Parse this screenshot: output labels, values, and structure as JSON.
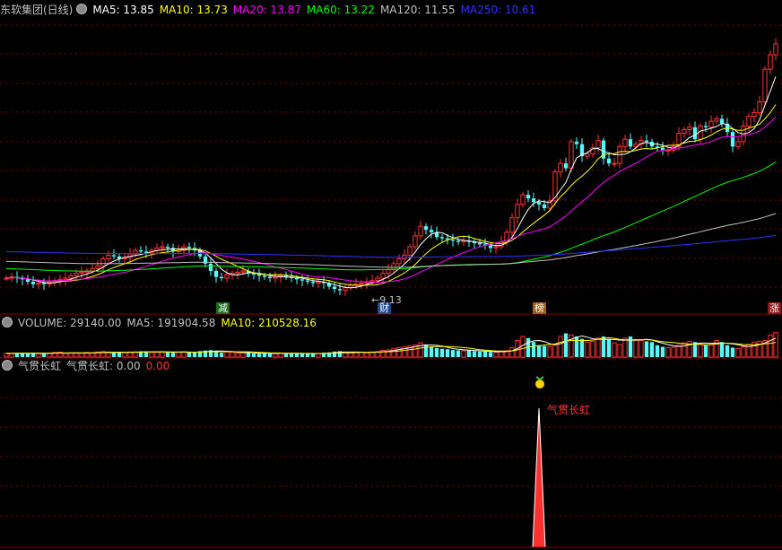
{
  "main_header": {
    "title": "东软集团(日线)",
    "ma": [
      {
        "label": "MA5: 13.85",
        "color": "#ffffff"
      },
      {
        "label": "MA10: 13.73",
        "color": "#ffff00"
      },
      {
        "label": "MA20: 13.87",
        "color": "#ff00ff"
      },
      {
        "label": "MA60: 13.22",
        "color": "#00ff00"
      },
      {
        "label": "MA120: 11.55",
        "color": "#c0c0c0"
      },
      {
        "label": "MA250: 10.61",
        "color": "#3030ff"
      }
    ]
  },
  "volume_header": {
    "label": "VOLUME: 29140.00",
    "ma5": "MA5: 191904.58",
    "ma10": "MA10: 210528.16"
  },
  "indicator_header": {
    "name": "气贯长虹",
    "value": "气贯长虹: 0.00",
    "value2": "0.00"
  },
  "markers": {
    "jian": "减",
    "cai": "财",
    "bang": "榜",
    "zhang": "涨",
    "low_price": "←9.13",
    "signal_label": "气贯长虹"
  },
  "colors": {
    "up": "#ff3232",
    "down": "#54fcfc",
    "grid": "#800000",
    "ma5": "#ffffff",
    "ma10": "#ffff00",
    "ma20": "#ff00ff",
    "ma60": "#00ff00",
    "ma120": "#c0c0c0",
    "ma250": "#3030ff"
  },
  "chart_data": [
    {
      "type": "candlestick",
      "title": "东软集团(日线)",
      "ylim": [
        8.5,
        20.5
      ],
      "x": [
        1,
        2,
        3,
        4,
        5,
        6,
        7,
        8,
        9,
        10,
        11,
        12,
        13,
        14,
        15,
        16,
        17,
        18,
        19,
        20,
        21,
        22,
        23,
        24,
        25,
        26,
        27,
        28,
        29,
        30,
        31,
        32,
        33,
        34,
        35,
        36,
        37,
        38,
        39,
        40,
        41,
        42,
        43,
        44,
        45,
        46,
        47,
        48,
        49,
        50,
        51,
        52,
        53,
        54,
        55,
        56,
        57,
        58,
        59,
        60,
        61,
        62,
        63,
        64,
        65,
        66,
        67,
        68,
        69,
        70,
        71,
        72,
        73,
        74,
        75,
        76,
        77,
        78,
        79,
        80,
        81,
        82,
        83,
        84,
        85,
        86,
        87,
        88,
        89,
        90,
        91,
        92,
        93,
        94,
        95,
        96,
        97,
        98,
        99,
        100,
        101,
        102,
        103,
        104,
        105,
        106,
        107,
        108,
        109,
        110,
        111,
        112,
        113,
        114,
        115,
        116,
        117,
        118,
        119,
        120,
        121,
        122,
        123,
        124,
        125,
        126,
        127,
        128,
        129,
        130,
        131,
        132,
        133,
        134,
        135,
        136,
        137,
        138,
        139,
        140,
        141,
        142,
        143,
        144
      ],
      "open": [
        9.8,
        9.8,
        9.85,
        9.8,
        9.75,
        9.65,
        9.55,
        9.6,
        9.55,
        9.65,
        9.7,
        9.75,
        9.8,
        9.9,
        10.0,
        10.05,
        10.1,
        10.2,
        10.3,
        10.6,
        10.75,
        10.7,
        10.6,
        10.65,
        10.8,
        10.95,
        10.9,
        10.85,
        10.95,
        11.05,
        11.1,
        11.05,
        10.9,
        10.95,
        11.1,
        11.05,
        10.95,
        10.7,
        10.4,
        10.1,
        9.85,
        9.8,
        9.95,
        10.0,
        10.05,
        10.1,
        10.0,
        9.95,
        9.9,
        9.85,
        9.8,
        9.85,
        9.9,
        9.85,
        9.8,
        9.75,
        9.7,
        9.65,
        9.6,
        9.65,
        9.6,
        9.45,
        9.35,
        9.3,
        9.4,
        9.5,
        9.55,
        9.6,
        9.65,
        9.7,
        9.8,
        10.0,
        10.15,
        10.4,
        10.6,
        10.75,
        11.1,
        11.55,
        11.95,
        11.8,
        11.7,
        11.5,
        11.45,
        11.4,
        11.35,
        11.3,
        11.35,
        11.3,
        11.25,
        11.2,
        11.15,
        11.05,
        11.1,
        11.3,
        11.7,
        12.3,
        12.85,
        13.25,
        13.1,
        12.95,
        12.85,
        12.7,
        13.0,
        14.2,
        14.55,
        14.35,
        15.45,
        15.35,
        14.85,
        14.95,
        15.2,
        15.5,
        14.75,
        14.55,
        14.55,
        15.25,
        15.55,
        15.25,
        15.35,
        15.5,
        15.45,
        15.25,
        15.2,
        15.1,
        15.1,
        15.25,
        15.8,
        15.95,
        16.05,
        15.55,
        16.1,
        16.05,
        16.3,
        16.4,
        16.2,
        15.85,
        15.25,
        15.45,
        16.1,
        16.5,
        16.65,
        17.1,
        18.45,
        19.05
      ],
      "close": [
        9.8,
        9.85,
        9.8,
        9.75,
        9.65,
        9.55,
        9.6,
        9.55,
        9.65,
        9.7,
        9.75,
        9.8,
        9.9,
        10.0,
        10.05,
        10.1,
        10.2,
        10.3,
        10.6,
        10.75,
        10.7,
        10.6,
        10.65,
        10.8,
        10.95,
        10.9,
        10.85,
        10.95,
        11.05,
        11.1,
        11.05,
        10.9,
        10.95,
        11.1,
        11.05,
        10.95,
        10.7,
        10.4,
        10.1,
        9.85,
        9.8,
        9.95,
        10.0,
        10.05,
        10.1,
        10.0,
        9.95,
        9.9,
        9.85,
        9.8,
        9.85,
        9.9,
        9.85,
        9.8,
        9.75,
        9.7,
        9.65,
        9.6,
        9.65,
        9.6,
        9.45,
        9.35,
        9.3,
        9.4,
        9.5,
        9.55,
        9.6,
        9.65,
        9.7,
        9.8,
        10.0,
        10.15,
        10.4,
        10.6,
        10.75,
        11.1,
        11.55,
        11.95,
        11.8,
        11.7,
        11.5,
        11.45,
        11.4,
        11.35,
        11.3,
        11.35,
        11.3,
        11.25,
        11.2,
        11.15,
        11.05,
        11.1,
        11.3,
        11.7,
        12.3,
        12.85,
        13.25,
        13.1,
        12.95,
        12.85,
        12.7,
        13.0,
        14.2,
        14.55,
        14.35,
        15.45,
        15.35,
        14.85,
        14.95,
        15.2,
        15.5,
        14.75,
        14.55,
        14.55,
        15.25,
        15.55,
        15.25,
        15.35,
        15.5,
        15.45,
        15.25,
        15.2,
        15.1,
        15.1,
        15.25,
        15.8,
        15.95,
        16.05,
        15.55,
        16.1,
        16.05,
        16.3,
        16.4,
        16.2,
        15.85,
        15.25,
        15.45,
        16.1,
        16.5,
        16.65,
        17.1,
        18.45,
        19.05,
        19.5
      ]
    },
    {
      "type": "bar",
      "title": "VOLUME",
      "ylim": [
        0,
        680000
      ],
      "values": [
        95000,
        90000,
        100000,
        105000,
        85000,
        110000,
        95000,
        90000,
        100000,
        120000,
        125000,
        90000,
        95000,
        110000,
        105000,
        120000,
        100000,
        130000,
        140000,
        130000,
        110000,
        115000,
        120000,
        130000,
        135000,
        145000,
        140000,
        120000,
        130000,
        135000,
        120000,
        110000,
        125000,
        135000,
        120000,
        115000,
        150000,
        165000,
        175000,
        160000,
        110000,
        130000,
        120000,
        100000,
        110000,
        115000,
        90000,
        85000,
        110000,
        95000,
        90000,
        105000,
        85000,
        100000,
        90000,
        85000,
        80000,
        95000,
        90000,
        110000,
        120000,
        140000,
        150000,
        120000,
        110000,
        120000,
        125000,
        110000,
        130000,
        140000,
        170000,
        180000,
        220000,
        240000,
        260000,
        280000,
        310000,
        360000,
        320000,
        260000,
        230000,
        210000,
        200000,
        180000,
        170000,
        160000,
        175000,
        150000,
        140000,
        145000,
        130000,
        120000,
        140000,
        160000,
        240000,
        420000,
        520000,
        480000,
        380000,
        300000,
        280000,
        260000,
        320000,
        520000,
        600000,
        560000,
        520000,
        460000,
        380000,
        400000,
        480000,
        520000,
        460000,
        360000,
        320000,
        480000,
        520000,
        440000,
        420000,
        400000,
        380000,
        300000,
        260000,
        240000,
        250000,
        300000,
        360000,
        400000,
        380000,
        330000,
        300000,
        340000,
        420000,
        380000,
        300000,
        240000,
        220000,
        260000,
        320000,
        380000,
        400000,
        420000,
        560000,
        620000
      ]
    }
  ]
}
